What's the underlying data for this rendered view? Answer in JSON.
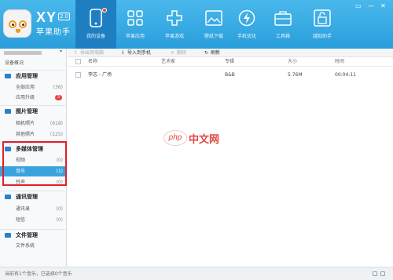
{
  "app": {
    "name": "XY",
    "version": "2.0",
    "subtitle": "苹果助手"
  },
  "nav": [
    {
      "label": "我的设备",
      "icon": "phone-icon",
      "active": true,
      "notify": true
    },
    {
      "label": "苹果应用",
      "icon": "apps-grid-icon"
    },
    {
      "label": "苹果游戏",
      "icon": "gamepad-cross-icon"
    },
    {
      "label": "壁纸下载",
      "icon": "picture-icon"
    },
    {
      "label": "手机优化",
      "icon": "lightning-icon"
    },
    {
      "label": "工具箱",
      "icon": "toolbox-icon"
    },
    {
      "label": "越狱助手",
      "icon": "unlock-icon"
    }
  ],
  "window_controls": [
    "▭",
    "—",
    "✕"
  ],
  "sidebar": {
    "device_chevron": "▾",
    "device_overview": "设备概况",
    "groups": [
      {
        "title": "应用管理",
        "items": [
          {
            "label": "全部应用",
            "count": "(36)"
          },
          {
            "label": "应用升级",
            "badge": "3"
          }
        ]
      },
      {
        "title": "图片管理",
        "items": [
          {
            "label": "相机照片",
            "count": "(618)"
          },
          {
            "label": "其他照片",
            "count": "(125)"
          }
        ]
      },
      {
        "title": "多媒体管理",
        "items": [
          {
            "label": "视频",
            "count": "(0)"
          },
          {
            "label": "音乐",
            "count": "(1)",
            "selected": true
          },
          {
            "label": "铃声",
            "count": "(0)"
          }
        ]
      },
      {
        "title": "通讯管理",
        "items": [
          {
            "label": "通讯录",
            "count": "(0)"
          },
          {
            "label": "短信",
            "count": "(0)"
          }
        ]
      },
      {
        "title": "文件管理",
        "items": [
          {
            "label": "文件系统",
            "count": ""
          }
        ]
      }
    ]
  },
  "toolbar": {
    "export_label": "导出到电脑",
    "import_label": "导入到手机",
    "delete_label": "删除",
    "refresh_label": "刷新"
  },
  "table": {
    "columns": [
      "名称",
      "艺术家",
      "专辑",
      "大小",
      "时间"
    ],
    "rows": [
      {
        "name": "李志 - 广场",
        "artist": "",
        "album": "B&B",
        "size": "5.76M",
        "time": "00:04:11"
      }
    ]
  },
  "watermark": {
    "php": "php",
    "cn": "中文网"
  },
  "status": {
    "text": "当前有1个音乐，已选择0个音乐"
  },
  "colors": {
    "header": "#2a9edc",
    "active_nav": "#1d7fc2",
    "selected_row": "#3aa3de",
    "highlight_box": "#e0202a",
    "badge": "#e8433c"
  }
}
